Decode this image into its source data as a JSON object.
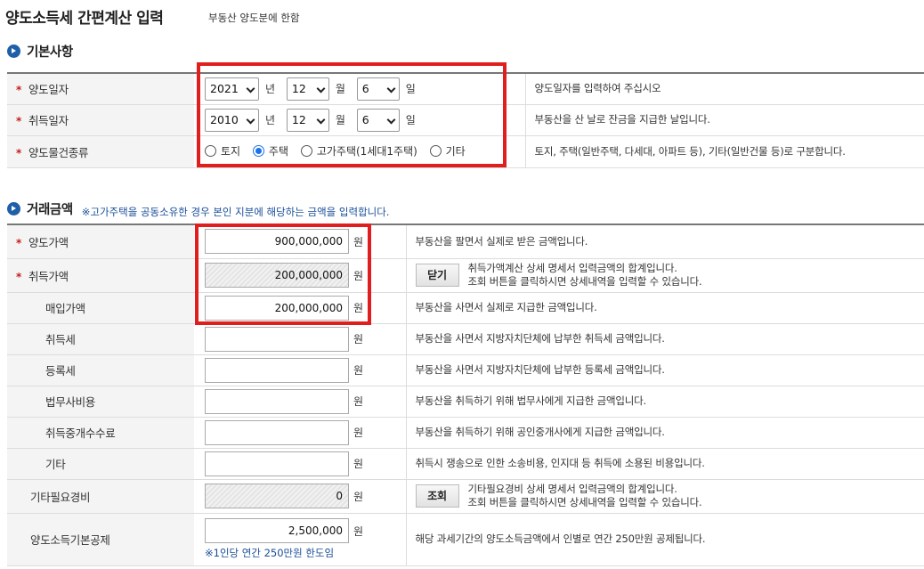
{
  "header": {
    "title": "양도소득세 간편계산 입력",
    "subtitle": "부동산 양도분에 한함"
  },
  "basic": {
    "section_title": "기본사항",
    "required_mark": "*",
    "rows": {
      "transfer_date": {
        "label": "양도일자",
        "year": "2021",
        "year_unit": "년",
        "month": "12",
        "month_unit": "월",
        "day": "6",
        "day_unit": "일",
        "desc": "양도일자를 입력하여 주십시오"
      },
      "acquisition_date": {
        "label": "취득일자",
        "year": "2010",
        "year_unit": "년",
        "month": "12",
        "month_unit": "월",
        "day": "6",
        "day_unit": "일",
        "desc": "부동산을 산 날로 잔금을 지급한 날입니다."
      },
      "property_type": {
        "label": "양도물건종류",
        "options": [
          "토지",
          "주택",
          "고가주택(1세대1주택)",
          "기타"
        ],
        "selected": "주택",
        "desc": "토지, 주택(일반주택, 다세대, 아파트 등), 기타(일반건물 등)로 구분합니다."
      }
    }
  },
  "trade": {
    "section_title": "거래금액",
    "section_note": "※고가주택을 공동소유한 경우 본인 지분에 해당하는 금액을 입력합니다.",
    "won": "원",
    "rows": {
      "transfer_price": {
        "label": "양도가액",
        "value": "900,000,000",
        "desc": "부동산을 팔면서 실제로 받은 금액입니다."
      },
      "acquisition_price": {
        "label": "취득가액",
        "value": "200,000,000",
        "button": "닫기",
        "desc1": "취득가액계산 상세 명세서 입력금액의 합계입니다.",
        "desc2": "조회 버튼을 클릭하시면 상세내역을 입력할 수 있습니다."
      },
      "purchase_price": {
        "label": "매입가액",
        "value": "200,000,000",
        "desc": "부동산을 사면서 실제로 지급한 금액입니다."
      },
      "acquisition_tax": {
        "label": "취득세",
        "value": "",
        "desc": "부동산을 사면서 지방자치단체에 납부한 취득세 금액입니다."
      },
      "registration_tax": {
        "label": "등록세",
        "value": "",
        "desc": "부동산을 사면서 지방자치단체에 납부한 등록세 금액입니다."
      },
      "legal_fee": {
        "label": "법무사비용",
        "value": "",
        "desc": "부동산을 취득하기 위해 법무사에게 지급한 금액입니다."
      },
      "broker_fee": {
        "label": "취득중개수수료",
        "value": "",
        "desc": "부동산을 취득하기 위해 공인중개사에게 지급한 금액입니다."
      },
      "other": {
        "label": "기타",
        "value": "",
        "desc": "취득시 쟁송으로 인한 소송비용, 인지대 등 취득에 소용된 비용입니다."
      },
      "other_expenses": {
        "label": "기타필요경비",
        "value": "0",
        "button": "조회",
        "desc1": "기타필요경비 상세 명세서 입력금액의 합계입니다.",
        "desc2": "조회 버튼을 클릭하시면 상세내역을 입력할 수 있습니다."
      },
      "basic_deduction": {
        "label": "양도소득기본공제",
        "value": "2,500,000",
        "hint": "※1인당 연간 250만원 한도임",
        "desc": "해당 과세기간의 양도소득금액에서 인별로 연간 250만원 공제됩니다."
      }
    }
  },
  "colors": {
    "highlight_box": "#e01e1e",
    "section_icon": "#1f5fa8",
    "note_text": "#1a4f99",
    "required": "#c81a1a"
  }
}
